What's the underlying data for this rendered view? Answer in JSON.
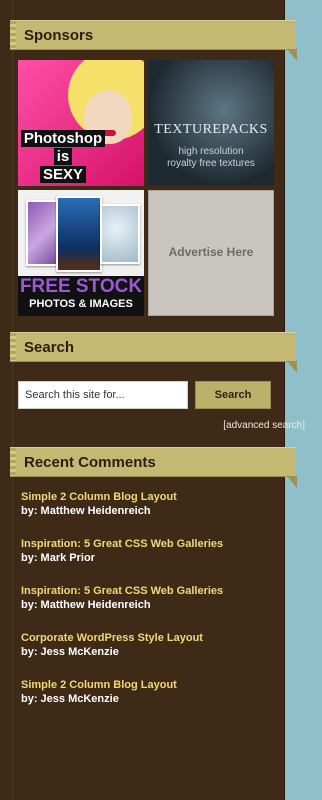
{
  "colors": {
    "sidebar_bg": "#3f2a18",
    "heading_bg": "#c5b873",
    "accent_link": "#f1d877",
    "page_bg": "#8fbfcb"
  },
  "sponsors": {
    "title": "Sponsors",
    "ads": [
      {
        "name": "photoshop-is-sexy-ad",
        "lines": [
          "Photoshop",
          "is",
          "SEXY"
        ]
      },
      {
        "name": "texturepacks-ad",
        "brand": "TEXTUREPACKS",
        "tagline_1": "high resolution",
        "tagline_2": "royalty free textures"
      },
      {
        "name": "free-stock-photos-ad",
        "line_1": "FREE STOCK",
        "line_2": "PHOTOS & IMAGES"
      },
      {
        "name": "advertise-here-ad",
        "text": "Advertise Here"
      }
    ]
  },
  "search": {
    "title": "Search",
    "input_value": "Search this site for...",
    "button_label": "Search",
    "advanced_link": "[advanced search]"
  },
  "recent_comments": {
    "title": "Recent Comments",
    "items": [
      {
        "post": "Simple 2 Column Blog Layout",
        "by": "by: Matthew Heidenreich"
      },
      {
        "post": "Inspiration: 5 Great CSS Web Galleries",
        "by": "by: Mark Prior"
      },
      {
        "post": "Inspiration: 5 Great CSS Web Galleries",
        "by": "by: Matthew Heidenreich"
      },
      {
        "post": "Corporate WordPress Style Layout",
        "by": "by: Jess McKenzie"
      },
      {
        "post": "Simple 2 Column Blog Layout",
        "by": "by: Jess McKenzie"
      }
    ]
  }
}
